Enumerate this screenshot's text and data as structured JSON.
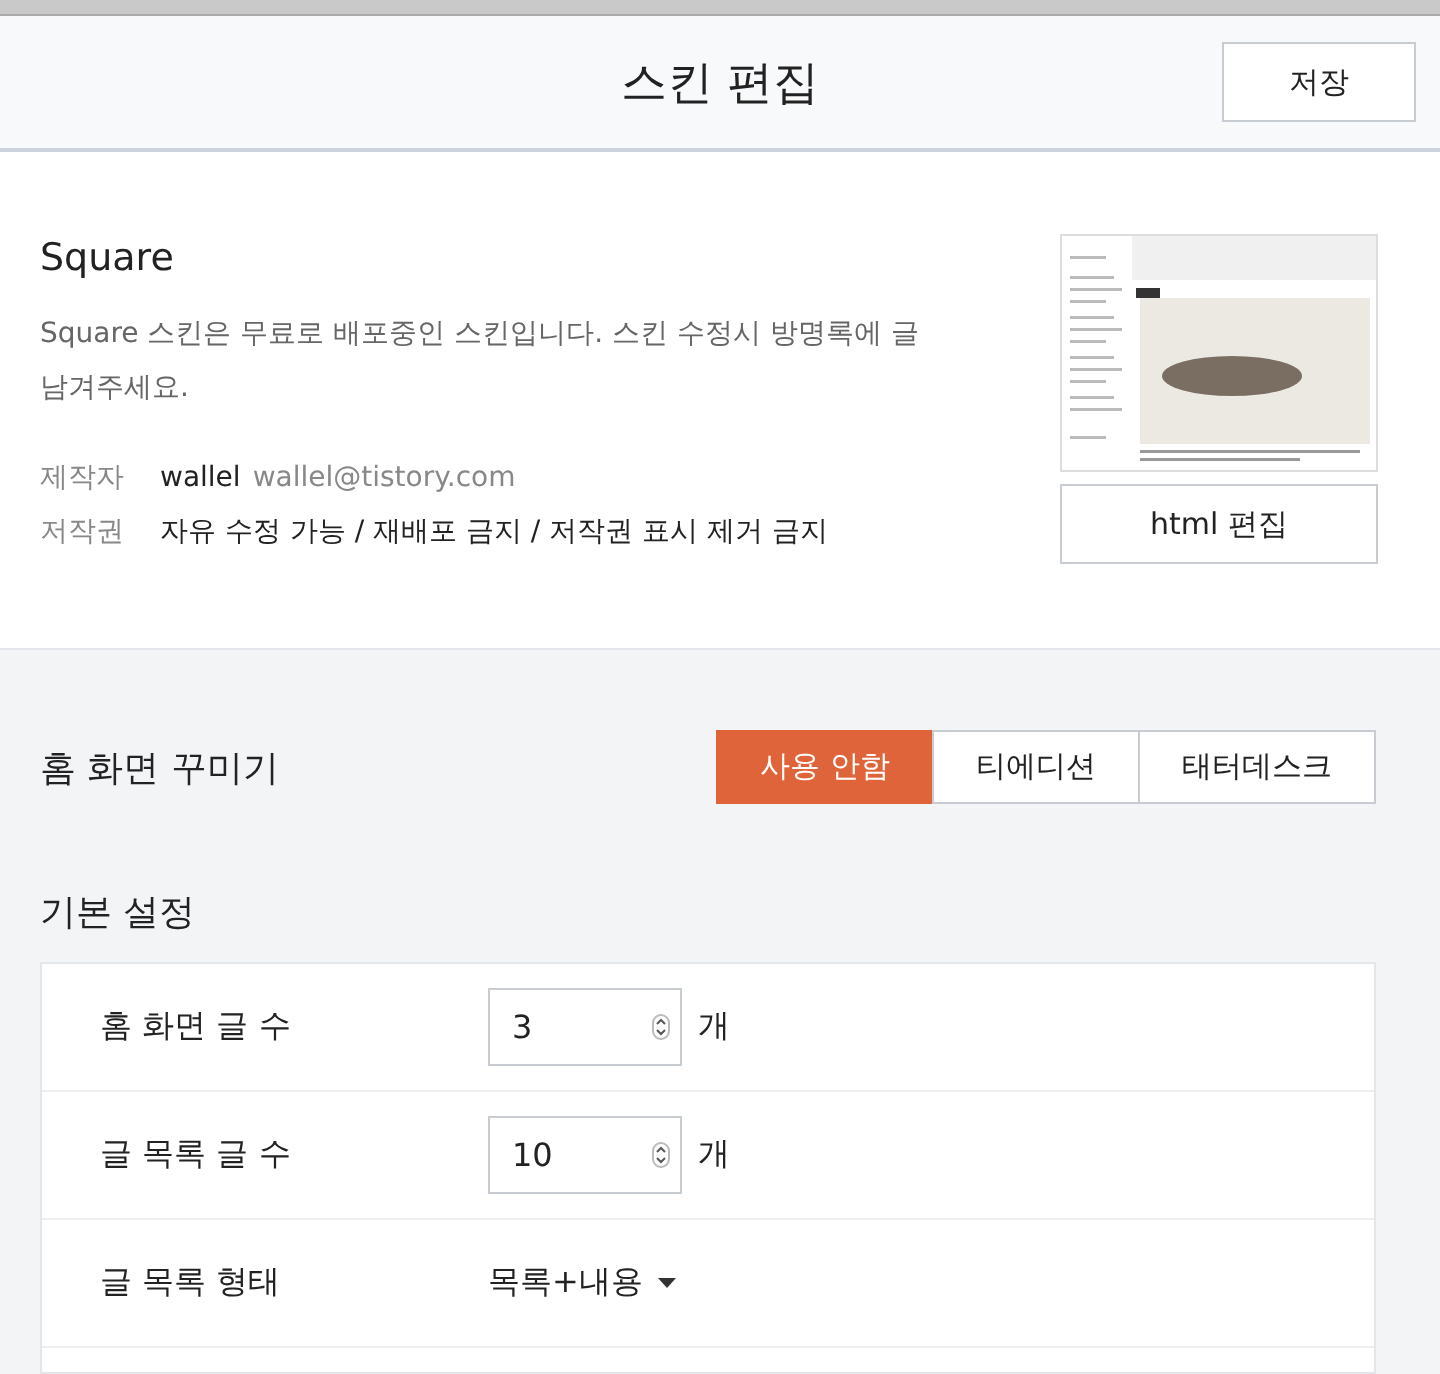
{
  "header": {
    "title": "스킨 편집",
    "save_button": "저장"
  },
  "skin": {
    "name": "Square",
    "description": "Square 스킨은 무료로 배포중인 스킨입니다. 스킨 수정시 방명록에 글 남겨주세요.",
    "author_label": "제작자",
    "author_name": "wallel",
    "author_email": "wallel@tistory.com",
    "license_label": "저작권",
    "license": "자유 수정 가능 / 재배포 금지 / 저작권 표시 제거 금지",
    "html_edit_button": "html 편집"
  },
  "home": {
    "title": "홈 화면 꾸미기",
    "options": [
      {
        "label": "사용 안함",
        "selected": true
      },
      {
        "label": "티에디션",
        "selected": false
      },
      {
        "label": "태터데스크",
        "selected": false
      }
    ]
  },
  "basic": {
    "title": "기본 설정",
    "rows": [
      {
        "kind": "number",
        "label": "홈 화면 글 수",
        "value": "3",
        "unit": "개"
      },
      {
        "kind": "number",
        "label": "글 목록 글 수",
        "value": "10",
        "unit": "개"
      },
      {
        "kind": "select",
        "label": "글 목록 형태",
        "value": "목록+내용"
      }
    ]
  }
}
